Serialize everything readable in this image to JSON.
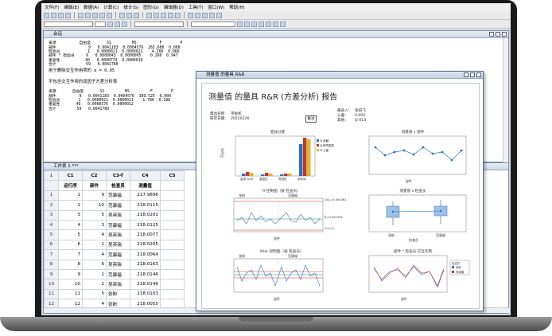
{
  "menu": [
    "文件(F)",
    "编辑(E)",
    "数据(A)",
    "计算(C)",
    "统计(S)",
    "图形(G)",
    "编辑器(D)",
    "工具(T)",
    "窗口(W)",
    "帮助(H)"
  ],
  "session": {
    "title": "会话",
    "table1_header": "来源          自由度       SS         MS          F        P",
    "table1_rows": [
      "部件              9   0.0041183  0.0004576  265.680  0.000",
      "检验员            1   0.0000021  0.0000021    4.360  0.066",
      "部件 * 检验员     9   0.0000043  0.0000005    0.260  0.947",
      "重复性           40   0.0000733  0.0000018",
      "合计             59   0.0041780"
    ],
    "alpha_line": "用于删除交互作用项的 α = 0.05",
    "no_interaction_title": "不包含交互作用的双因子方差分析表",
    "table2_header": "来源       自由度       SS         MS         F        P",
    "table2_rows": [
      "部件          9   0.0041183  0.0004576  389.525  0.000",
      "检验员        1   0.0000021  0.0000021    1.780  0.188",
      "重复性       49   0.0000576  0.0000012",
      "合计         59   0.0041780"
    ]
  },
  "worksheet": {
    "title": "工作表 1 ***",
    "col_ids": [
      "C1",
      "C2",
      "C3-T",
      "C4",
      "C5"
    ],
    "col_names": [
      "运行序",
      "部件",
      "检查员",
      "测量值",
      ""
    ],
    "rows": [
      [
        "1",
        "1",
        "9",
        "范康福",
        "217.9896"
      ],
      [
        "2",
        "2",
        "10",
        "范康福",
        "218.0115"
      ],
      [
        "3",
        "3",
        "5",
        "吴英瑞",
        "218.0201"
      ],
      [
        "4",
        "4",
        "3",
        "范康福",
        "218.0125"
      ],
      [
        "5",
        "5",
        "4",
        "吴英瑞",
        "218.0077"
      ],
      [
        "6",
        "6",
        "1",
        "吴英瑞",
        "218.0205"
      ],
      [
        "7",
        "7",
        "4",
        "范康福",
        "218.0064"
      ],
      [
        "8",
        "8",
        "6",
        "吴英瑞",
        "218.0163"
      ],
      [
        "9",
        "9",
        "1",
        "范康福",
        "218.0146"
      ],
      [
        "10",
        "10",
        "2",
        "吴英瑞",
        "218.0146"
      ],
      [
        "11",
        "11",
        "5",
        "张盼",
        "218.0103"
      ],
      [
        "12",
        "12",
        "4",
        "张盼",
        "218.0055"
      ]
    ]
  },
  "graph": {
    "window_title": "测量值 的量具 R&R",
    "report_title": "测量值 的量具 R&R (方差分析) 报告",
    "meta_left": [
      "量具名称:",
      "研究日期:"
    ],
    "meta_left_vals": [
      "平板机",
      "20220226"
    ],
    "meta_right": [
      "报表人:",
      "公差:",
      "其他:"
    ],
    "meta_right_vals": [
      "张旧飞",
      "0.005",
      "Q-013"
    ],
    "remark": "备注",
    "p1_title": "变异分量",
    "p1_ylabel": "百分比",
    "p1_cats": [
      "量具 R&R",
      "重复性",
      "再现性",
      "部件间"
    ],
    "p1_legend": [
      "% 贡献",
      "% 研究变异",
      "% 公差"
    ],
    "p2_title": "测量值 x 部件",
    "p2_xlabel": "部件",
    "p3_title": "R 控制图（按 检查员）",
    "p3_groups": [
      "张盼",
      "范康福"
    ],
    "p3_ylabel": "样本极差",
    "p3_ucl": "UCL=0.004361",
    "p3_rbar": "R̄=0.001335",
    "p3_lcl": "LCL=0",
    "p3_xlabel": "部件",
    "p4_title": "测量值 x 检查员",
    "p4_xlabel": "检查员",
    "p4_xcats": [
      "张盼",
      "范康福"
    ],
    "p5_title": "Xbar 控制图（按 检查员）",
    "p5_ylabel": "样本均值",
    "p5_xlabel": "部件",
    "p6_title": "部件 * 检查员 交互作用",
    "p6_xlabel": "部件",
    "p6_ylabel": "均值",
    "p6_legend_title": "检查员",
    "p6_legend": [
      "张盼",
      "范康福"
    ]
  }
}
